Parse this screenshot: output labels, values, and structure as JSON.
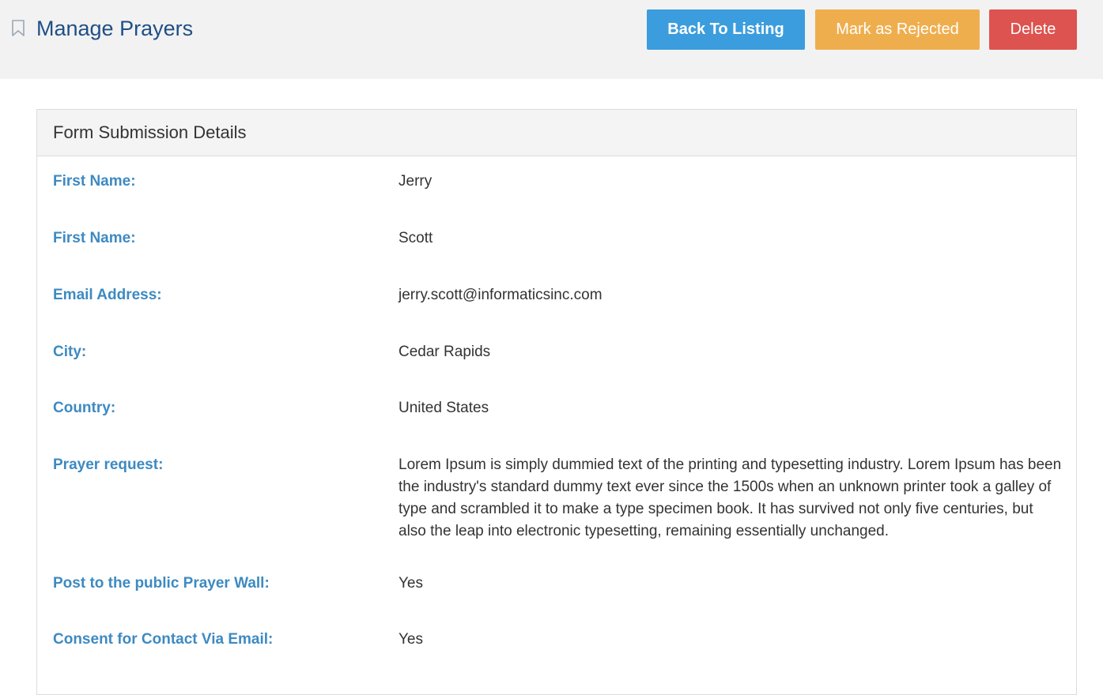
{
  "header": {
    "title": "Manage Prayers",
    "icon": "bookmark-icon",
    "buttons": {
      "back": "Back To Listing",
      "reject": "Mark as Rejected",
      "delete": "Delete"
    },
    "colors": {
      "back": "#3b9ddd",
      "reject": "#efae4e",
      "delete": "#dd534f"
    }
  },
  "panel": {
    "heading": "Form Submission Details",
    "fields": [
      {
        "label": "First Name:",
        "value": "Jerry"
      },
      {
        "label": "First Name:",
        "value": "Scott"
      },
      {
        "label": "Email Address:",
        "value": "jerry.scott@informaticsinc.com"
      },
      {
        "label": "City:",
        "value": "Cedar Rapids"
      },
      {
        "label": "Country:",
        "value": "United States"
      },
      {
        "label": "Prayer request:",
        "value": "Lorem Ipsum is simply dummied text of the printing and typesetting industry. Lorem Ipsum has been the industry's standard dummy text ever since the 1500s when an unknown printer took a galley of type and scrambled it to make a type specimen book. It has survived not only five centuries, but also the leap into electronic typesetting, remaining essentially unchanged."
      },
      {
        "label": "Post to the public Prayer Wall:",
        "value": "Yes"
      },
      {
        "label": "Consent for Contact Via Email:",
        "value": "Yes"
      }
    ]
  }
}
